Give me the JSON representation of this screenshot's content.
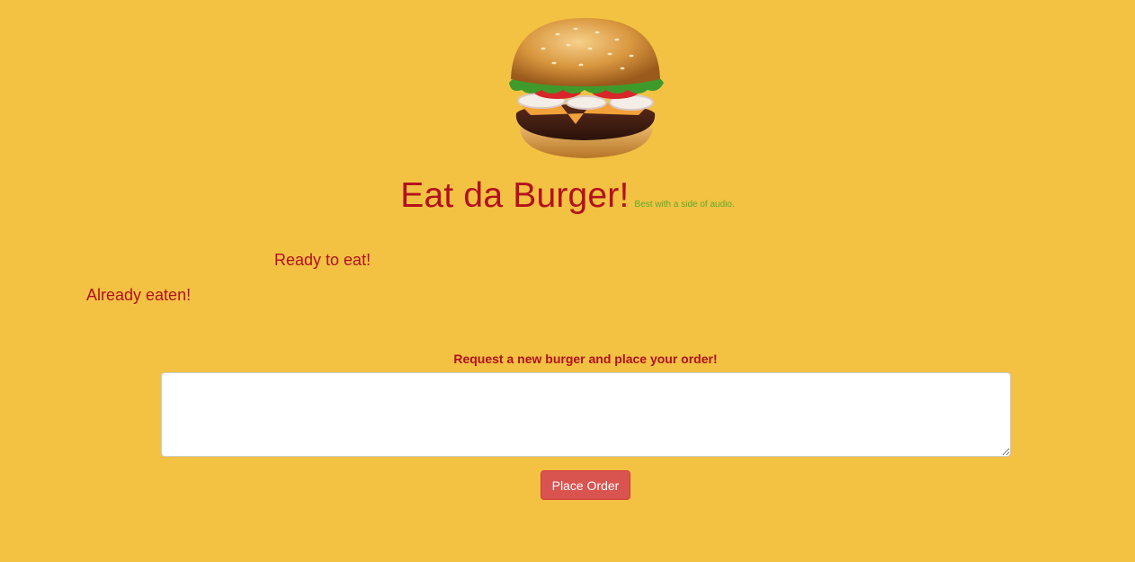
{
  "header": {
    "title": "Eat da Burger!",
    "subtitle": "Best with a side of audio."
  },
  "logo": {
    "icon": "burger-icon"
  },
  "lists": {
    "ready_heading": "Ready to eat!",
    "eaten_heading": "Already eaten!"
  },
  "order_form": {
    "label": "Request a new burger and place your order!",
    "textarea_value": "",
    "button_label": "Place Order"
  },
  "colors": {
    "background": "#f3c242",
    "title_red": "#b3101f",
    "subtitle_green": "#5aaa2c",
    "button_red": "#d9534f"
  }
}
